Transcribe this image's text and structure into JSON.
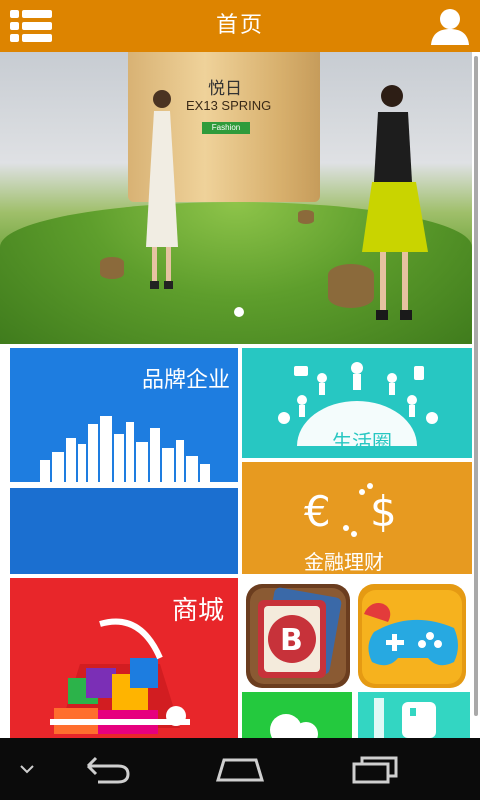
{
  "header": {
    "title": "首页",
    "menu_icon": "list-menu-icon",
    "user_icon": "user-icon",
    "background": "#dd8400"
  },
  "banner": {
    "brand_text": "悦日",
    "subtitle": "EX13 SPRING",
    "tag": "Fashion",
    "active_slide": 1,
    "slide_count": 1
  },
  "tiles": {
    "brand": {
      "label": "品牌企业",
      "color": "#1e7de0",
      "icon": "city-skyline-icon"
    },
    "life": {
      "label": "生活圈",
      "color": "#27c7c2",
      "icon": "social-network-icon"
    },
    "finance": {
      "label": "金融理财",
      "color": "#e79a20",
      "icon": "currency-exchange-icon"
    },
    "mall": {
      "label": "商城",
      "color": "#e8262a",
      "icon": "shopping-basket-icon"
    },
    "app1": {
      "icon": "bitcoin-cards-icon"
    },
    "app2": {
      "icon": "gamepad-icon"
    },
    "app3": {
      "icon": "chat-bubble-icon",
      "color": "#24c93e"
    },
    "app4": {
      "icon": "phone-icon",
      "color": "#33d6c2"
    }
  },
  "navbar": {
    "icons": [
      "chevron-down-icon",
      "back-icon",
      "home-icon",
      "recent-apps-icon"
    ]
  }
}
